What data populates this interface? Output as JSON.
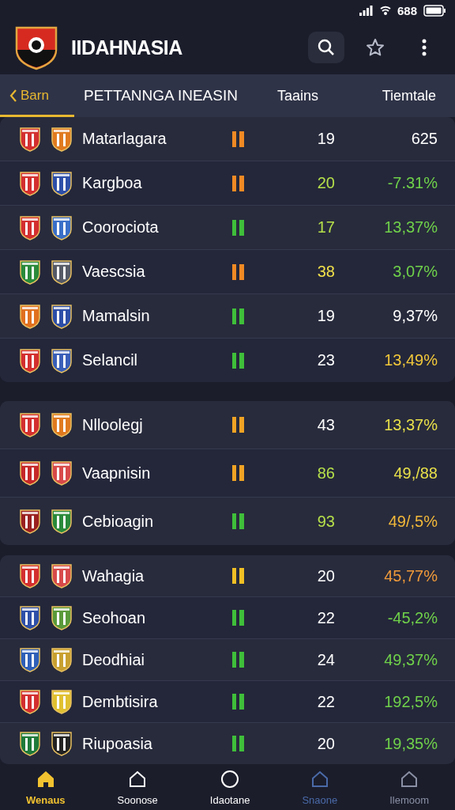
{
  "status_bar": {
    "battery_text": "688"
  },
  "header": {
    "title": "IIDAHNASIA"
  },
  "tabs": [
    {
      "label": "Barn",
      "selected": true
    },
    {
      "label": "PETTANNGA  INEASIN",
      "selected": false
    }
  ],
  "columns": [
    "Taains",
    "Tiemtale"
  ],
  "groups": [
    {
      "rows": [
        {
          "name": "Matarlagara",
          "crests": [
            {
              "color": "#d32f2f"
            },
            {
              "color": "#e07a1f"
            }
          ],
          "form": {
            "color": "#f08a24"
          },
          "played": {
            "text": "19",
            "color": "#ffffff"
          },
          "rate": {
            "text": "625",
            "color": "#ffffff"
          }
        },
        {
          "name": "Kargboa",
          "crests": [
            {
              "color": "#d32f2f"
            },
            {
              "color": "#2e4fa8"
            }
          ],
          "form": {
            "color": "#f08a24"
          },
          "played": {
            "text": "20",
            "color": "#b6e04a"
          },
          "rate": {
            "text": "-7.31%",
            "color": "#6fd14a"
          }
        },
        {
          "name": "Coorociota",
          "crests": [
            {
              "color": "#d32f2f"
            },
            {
              "color": "#3a6fc8"
            }
          ],
          "form": {
            "color": "#3fbf3a"
          },
          "played": {
            "text": "17",
            "color": "#b6e04a"
          },
          "rate": {
            "text": "13,37%",
            "color": "#6fd14a"
          }
        },
        {
          "name": "Vaescsia",
          "crests": [
            {
              "color": "#2a8a3a"
            },
            {
              "color": "#555a66"
            }
          ],
          "form": {
            "color": "#f08a24"
          },
          "played": {
            "text": "38",
            "color": "#f2e14a"
          },
          "rate": {
            "text": "3,07%",
            "color": "#6fd14a"
          }
        },
        {
          "name": "Mamalsin",
          "crests": [
            {
              "color": "#e0701f"
            },
            {
              "color": "#2e4fa8"
            }
          ],
          "form": {
            "color": "#3fbf3a"
          },
          "played": {
            "text": "19",
            "color": "#ffffff"
          },
          "rate": {
            "text": "9,37%",
            "color": "#ffffff"
          }
        },
        {
          "name": "Selancil",
          "crests": [
            {
              "color": "#d32f2f"
            },
            {
              "color": "#3a5fb8"
            }
          ],
          "form": {
            "color": "#3fbf3a"
          },
          "played": {
            "text": "23",
            "color": "#ffffff"
          },
          "rate": {
            "text": "13,49%",
            "color": "#f2c83a"
          }
        }
      ]
    },
    {
      "rows": [
        {
          "name": "Nlloolegj",
          "crests": [
            {
              "color": "#d32f2f"
            },
            {
              "color": "#e07a1f"
            }
          ],
          "form": {
            "color": "#f0a324"
          },
          "played": {
            "text": "43",
            "color": "#ffffff"
          },
          "rate": {
            "text": "13,37%",
            "color": "#e8e04a"
          }
        },
        {
          "name": "Vaapnisin",
          "crests": [
            {
              "color": "#c62828"
            },
            {
              "color": "#d84a4a"
            }
          ],
          "form": {
            "color": "#f0a324"
          },
          "played": {
            "text": "86",
            "color": "#b6e04a"
          },
          "rate": {
            "text": "49,/88",
            "color": "#e8e04a"
          }
        },
        {
          "name": "Cebioagin",
          "crests": [
            {
              "color": "#9a2020"
            },
            {
              "color": "#2a8a3a"
            }
          ],
          "form": {
            "color": "#3fbf3a"
          },
          "played": {
            "text": "93",
            "color": "#b6e04a"
          },
          "rate": {
            "text": "49/,5%",
            "color": "#f2b83a"
          }
        }
      ]
    },
    {
      "rows": [
        {
          "name": "Wahagia",
          "crests": [
            {
              "color": "#d32f2f"
            },
            {
              "color": "#d84a4a"
            }
          ],
          "form": {
            "color": "#f0c024"
          },
          "played": {
            "text": "20",
            "color": "#ffffff"
          },
          "rate": {
            "text": "45,77%",
            "color": "#f09a3a"
          }
        },
        {
          "name": "Seohoan",
          "crests": [
            {
              "color": "#2e4fa8"
            },
            {
              "color": "#5a9a3a"
            }
          ],
          "form": {
            "color": "#3fbf3a"
          },
          "played": {
            "text": "22",
            "color": "#ffffff"
          },
          "rate": {
            "text": "-45,2%",
            "color": "#6fd14a"
          }
        },
        {
          "name": "Deodhiai",
          "crests": [
            {
              "color": "#2e5fb8"
            },
            {
              "color": "#c8a030"
            }
          ],
          "form": {
            "color": "#3fbf3a"
          },
          "played": {
            "text": "24",
            "color": "#ffffff"
          },
          "rate": {
            "text": "49,37%",
            "color": "#6fd14a"
          }
        },
        {
          "name": "Dembtisira",
          "crests": [
            {
              "color": "#d32f2f"
            },
            {
              "color": "#e0c030"
            }
          ],
          "form": {
            "color": "#3fbf3a"
          },
          "played": {
            "text": "22",
            "color": "#ffffff"
          },
          "rate": {
            "text": "192,5%",
            "color": "#6fd14a"
          }
        },
        {
          "name": "Riupoasia",
          "crests": [
            {
              "color": "#1e7a3a"
            },
            {
              "color": "#222222"
            }
          ],
          "form": {
            "color": "#3fbf3a"
          },
          "played": {
            "text": "20",
            "color": "#ffffff"
          },
          "rate": {
            "text": "19,35%",
            "color": "#6fd14a"
          }
        }
      ]
    }
  ],
  "nav": [
    {
      "label": "Wenaus",
      "selected": true,
      "color": "#f2c230"
    },
    {
      "label": "Soonose",
      "selected": false,
      "color": "#ffffff"
    },
    {
      "label": "Idaotane",
      "selected": false,
      "color": "#ffffff"
    },
    {
      "label": "Snaone",
      "selected": false,
      "color": "#4a6aa8"
    },
    {
      "label": "Ilemoom",
      "selected": false,
      "color": "#8a90a4"
    }
  ]
}
